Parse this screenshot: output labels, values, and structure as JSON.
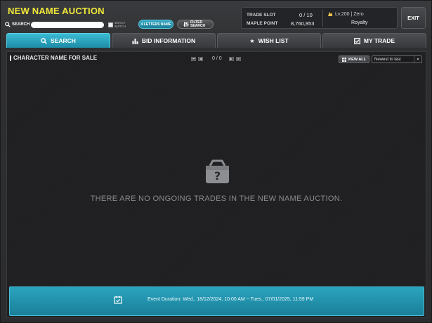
{
  "header": {
    "title": "NEW NAME AUCTION",
    "search_label": "SEARCH",
    "search_placeholder": "",
    "exact_match_label": "EXACT MATCH",
    "letters_button": "4 LETTERS NAME",
    "filter_button": "FILTER SEARCH",
    "exit_label": "EXIT"
  },
  "info": {
    "trade_slot_label": "TRADE SLOT",
    "trade_slot_value": "0 / 10",
    "maple_point_label": "MAPLE POINT",
    "maple_point_value": "8,760,853",
    "character_level": "Lv.200 | Zero",
    "world": "Royalty"
  },
  "tabs": [
    {
      "label": "SEARCH",
      "icon": "search-icon",
      "active": true
    },
    {
      "label": "BID INFORMATION",
      "icon": "bar-chart-icon",
      "active": false
    },
    {
      "label": "WISH LIST",
      "icon": "star-icon",
      "active": false
    },
    {
      "label": "MY TRADE",
      "icon": "checkbox-icon",
      "active": false
    }
  ],
  "main": {
    "section_title": "CHARACTER NAME FOR SALE",
    "pagination": "0 / 0",
    "view_all_label": "VIEW ALL",
    "sort_selected": "Newest to last",
    "empty_message": "THERE ARE NO ONGOING TRADES IN THE NEW NAME AUCTION."
  },
  "event": {
    "text": "Event Duration: Wed., 18/12/2024, 10:00 AM ~ Tues., 07/01/2025, 11:59 PM"
  },
  "colors": {
    "accent": "#2aa4bf",
    "title": "#f2e83a"
  }
}
